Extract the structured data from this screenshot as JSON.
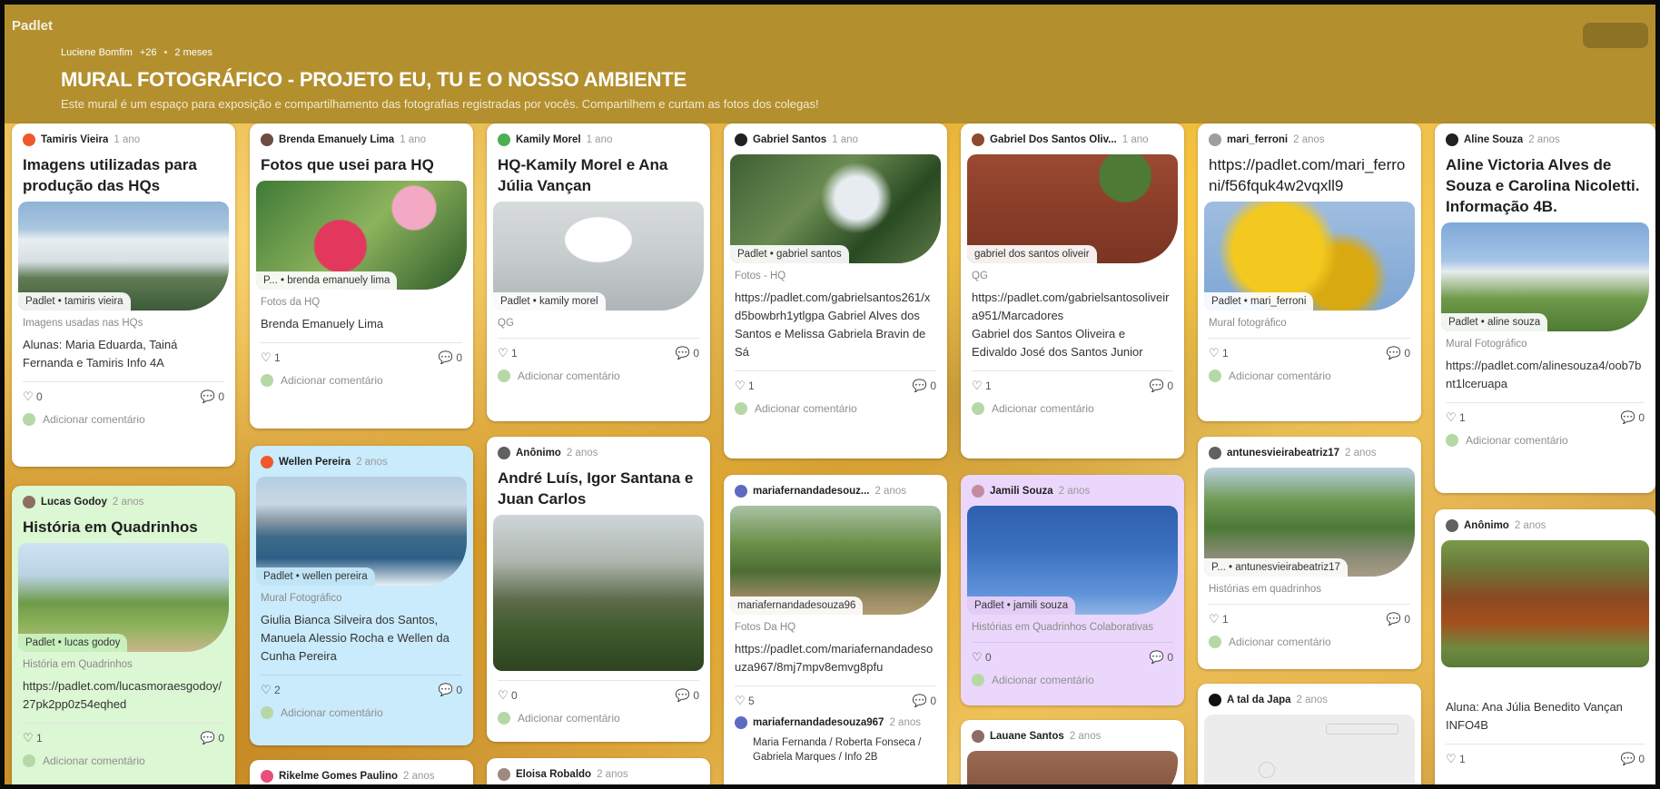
{
  "logo": "Padlet",
  "header": {
    "author": "Luciene Bomfim",
    "contributors": "+26",
    "time": "2 meses",
    "title": "MURAL FOTOGRÁFICO - PROJETO EU, TU E O NOSSO AMBIENTE",
    "description": "Este mural é um espaço para exposição e compartilhamento das fotografias registradas por vocês. Compartilhem e curtam as fotos dos colegas!"
  },
  "comment_placeholder": "Adicionar comentário",
  "colors": {
    "header": "#b38f2e",
    "card_green": "#dbf7d3",
    "card_blue": "#c9ebfb",
    "card_purple": "#ead7fb"
  },
  "cards": [
    {
      "author": "Tamiris Vieira",
      "time": "1 ano",
      "title": "Imagens utilizadas para produção das HQs",
      "attribution": "Padlet • tamiris vieira",
      "source": "Imagens usadas nas HQs",
      "body": "Alunas: Maria Eduarda, Tainá Fernanda e Tamiris Info 4A",
      "likes": "0",
      "comments": "0"
    },
    {
      "author": "Lucas Godoy",
      "time": "2 anos",
      "title": "História em Quadrinhos",
      "attribution": "Padlet • lucas godoy",
      "source": "História em Quadrinhos",
      "link": "https://padlet.com/lucasmoraesgodoy/27pk2pp0z54eqhed",
      "likes": "1",
      "comments": "0"
    },
    {
      "author": "Brenda Emanuely Lima",
      "time": "1 ano",
      "title": "Fotos que usei para HQ",
      "attribution": "P... • brenda emanuely lima",
      "source": "Fotos da HQ",
      "body": "Brenda Emanuely Lima",
      "likes": "1",
      "comments": "0"
    },
    {
      "author": "Wellen Pereira",
      "time": "2 anos",
      "attribution": "Padlet • wellen pereira",
      "source": "Mural Fotográfico",
      "body": "Giulia Bianca Silveira dos Santos, Manuela Alessio Rocha e Wellen da Cunha Pereira",
      "likes": "2",
      "comments": "0"
    },
    {
      "author": "Rikelme Gomes Paulino",
      "time": "2 anos"
    },
    {
      "author": "Kamily Morel",
      "time": "1 ano",
      "title": "HQ-Kamily Morel e Ana Júlia Vançan",
      "attribution": "Padlet • kamily morel",
      "source": "QG",
      "likes": "1",
      "comments": "0"
    },
    {
      "author": "Anônimo",
      "time": "2 anos",
      "title": "André Luís, Igor Santana e Juan Carlos",
      "likes": "0",
      "comments": "0"
    },
    {
      "author": "Eloisa Robaldo",
      "time": "2 anos"
    },
    {
      "author": "Gabriel Santos",
      "time": "1 ano",
      "attribution": "Padlet • gabriel santos",
      "source": "Fotos - HQ",
      "link": "https://padlet.com/gabrielsantos261/xd5bowbrh1ytlgpa",
      "body": "Gabriel Alves dos Santos e Melissa Gabriela Bravin de Sá",
      "likes": "1",
      "comments": "0"
    },
    {
      "author": "mariafernandadesouz...",
      "time": "2 anos",
      "attribution": "mariafernandadesouza96",
      "source": "Fotos Da HQ",
      "link": "https://padlet.com/mariafernandadesouza967/8mj7mpv8emvg8pfu",
      "likes": "5",
      "comments": "0"
    },
    {
      "author": "mariafernandadesouza967",
      "time": "2 anos",
      "body": "Maria Fernanda / Roberta Fonseca / Gabriela Marques / Info 2B"
    },
    {
      "author": "Gabriel Dos Santos Oliv...",
      "time": "1 ano",
      "attribution": "gabriel dos santos oliveir",
      "source": "QG",
      "link": "https://padlet.com/gabrielsantosoliveira951/Marcadores",
      "body": "Gabriel dos Santos Oliveira e Edivaldo José dos Santos Junior",
      "likes": "1",
      "comments": "0"
    },
    {
      "author": "Jamili Souza",
      "time": "2 anos",
      "attribution": "Padlet • jamili souza",
      "source": "Histórias em Quadrinhos Colaborativas",
      "likes": "0",
      "comments": "0"
    },
    {
      "author": "Lauane Santos",
      "time": "2 anos"
    },
    {
      "author": "mari_ferroni",
      "time": "2 anos",
      "title": "https://padlet.com/mari_ferroni/f56fquk4w2vqxll9",
      "attribution": "Padlet • mari_ferroni",
      "source": "Mural fotográfico",
      "likes": "1",
      "comments": "0"
    },
    {
      "author": "antunesvieirabeatriz17",
      "time": "2 anos",
      "attribution": "P... • antunesvieirabeatriz17",
      "source": "Histórias em quadrinhos",
      "likes": "1",
      "comments": "0"
    },
    {
      "author": "A tal da Japa",
      "time": "2 anos"
    },
    {
      "author": "Aline Souza",
      "time": "2 anos",
      "title": "Aline Victoria Alves de Souza e Carolina Nicoletti. Informação 4B.",
      "attribution": "Padlet • aline souza",
      "source": "Mural Fotográfico",
      "link": "https://padlet.com/alinesouza4/oob7bnt1lceruapa",
      "likes": "1",
      "comments": "0"
    },
    {
      "author": "Anônimo",
      "time": "2 anos",
      "body": "Aluna: Ana Júlia Benedito Vançan INFO4B",
      "likes": "1",
      "comments": "0"
    }
  ]
}
